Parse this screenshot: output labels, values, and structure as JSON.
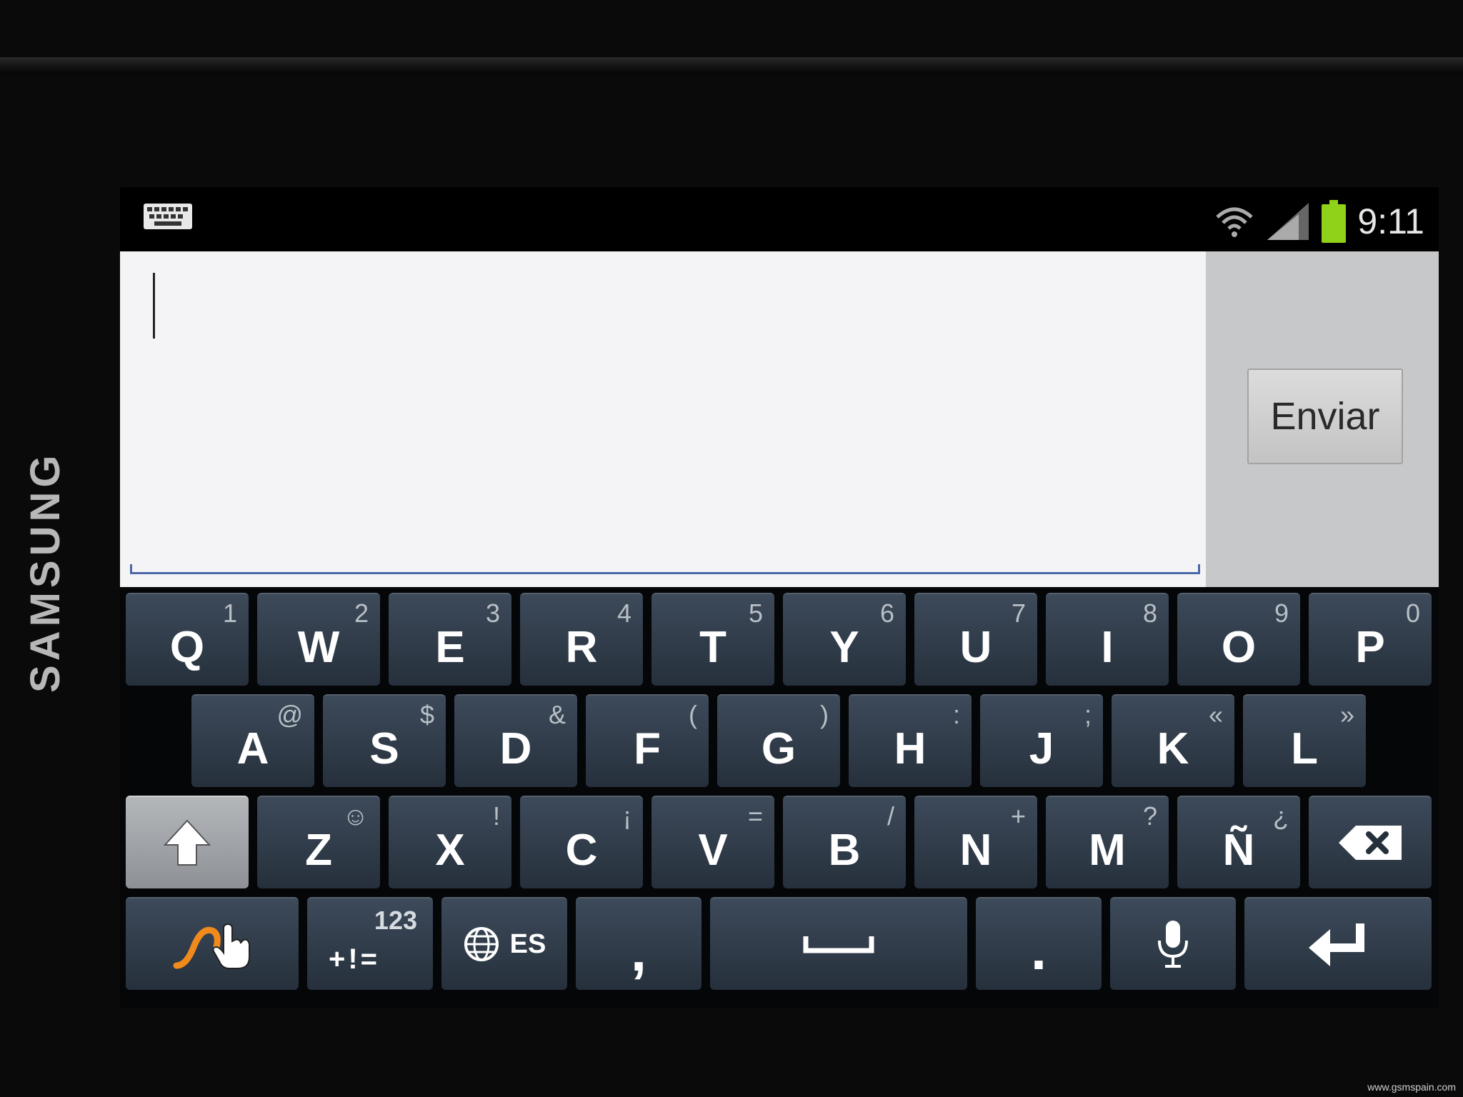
{
  "device": {
    "brand": "SAMSUNG",
    "watermark": "www.gsmspain.com"
  },
  "status_bar": {
    "time": "9:11",
    "icons": [
      "keyboard-notification-icon",
      "wifi-icon",
      "signal-icon",
      "battery-icon"
    ],
    "battery_color": "#8fd219"
  },
  "compose": {
    "message_value": "",
    "send_label": "Enviar"
  },
  "keyboard": {
    "row1": [
      {
        "key": "Q",
        "alt": "1"
      },
      {
        "key": "W",
        "alt": "2"
      },
      {
        "key": "E",
        "alt": "3"
      },
      {
        "key": "R",
        "alt": "4"
      },
      {
        "key": "T",
        "alt": "5"
      },
      {
        "key": "Y",
        "alt": "6"
      },
      {
        "key": "U",
        "alt": "7"
      },
      {
        "key": "I",
        "alt": "8"
      },
      {
        "key": "O",
        "alt": "9"
      },
      {
        "key": "P",
        "alt": "0"
      }
    ],
    "row2": [
      {
        "key": "A",
        "alt": "@"
      },
      {
        "key": "S",
        "alt": "$"
      },
      {
        "key": "D",
        "alt": "&"
      },
      {
        "key": "F",
        "alt": "("
      },
      {
        "key": "G",
        "alt": ")"
      },
      {
        "key": "H",
        "alt": ":"
      },
      {
        "key": "J",
        "alt": ";"
      },
      {
        "key": "K",
        "alt": "«"
      },
      {
        "key": "L",
        "alt": "»"
      }
    ],
    "row3": [
      {
        "key": "Z",
        "alt": "☺"
      },
      {
        "key": "X",
        "alt": "!"
      },
      {
        "key": "C",
        "alt": "¡"
      },
      {
        "key": "V",
        "alt": "="
      },
      {
        "key": "B",
        "alt": "/"
      },
      {
        "key": "N",
        "alt": "+"
      },
      {
        "key": "M",
        "alt": "?"
      },
      {
        "key": "Ñ",
        "alt": "¿"
      }
    ],
    "symbols_top": "123",
    "symbols_bottom": "+!=",
    "language": "ES",
    "comma": ",",
    "period": ".",
    "swype_color": "#f08a1c"
  }
}
